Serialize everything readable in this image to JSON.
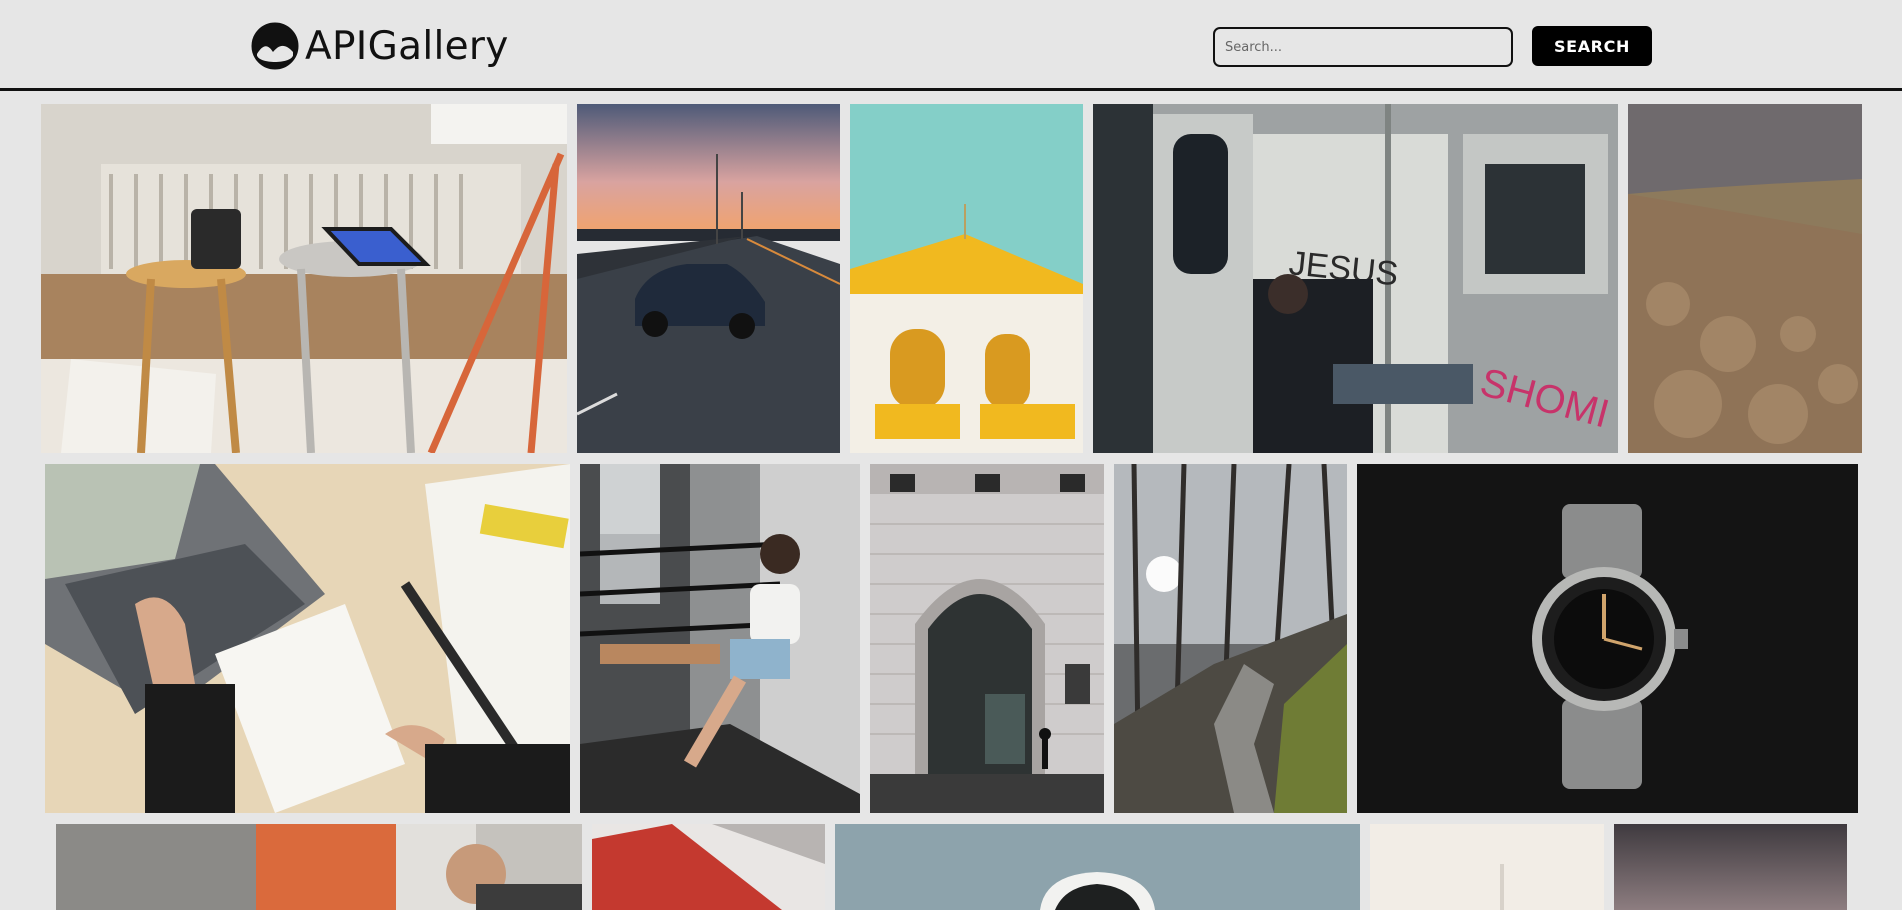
{
  "header": {
    "brand": "APIGallery",
    "logo_icon": "mountain-circle-icon",
    "search_placeholder": "Search...",
    "search_value": "",
    "search_button_label": "SEARCH"
  },
  "colors": {
    "background": "#e6e6e6",
    "header_border": "#111111",
    "button_bg": "#000000",
    "button_text": "#ffffff"
  },
  "gallery": {
    "photos": [
      {
        "subject": "laptop on stool"
      },
      {
        "subject": "car on road at sunset"
      },
      {
        "subject": "yellow white building"
      },
      {
        "subject": "man on subway with graffiti"
      },
      {
        "subject": "rocky mountain valley"
      },
      {
        "subject": "laptop notebook desk"
      },
      {
        "subject": "woman on balcony"
      },
      {
        "subject": "building arch doorway"
      },
      {
        "subject": "forest path"
      },
      {
        "subject": "wristwatch"
      },
      {
        "subject": "man in studio"
      },
      {
        "subject": "red railing"
      },
      {
        "subject": "observatory dome"
      },
      {
        "subject": "hazy city"
      },
      {
        "subject": "dusk sky"
      }
    ]
  }
}
